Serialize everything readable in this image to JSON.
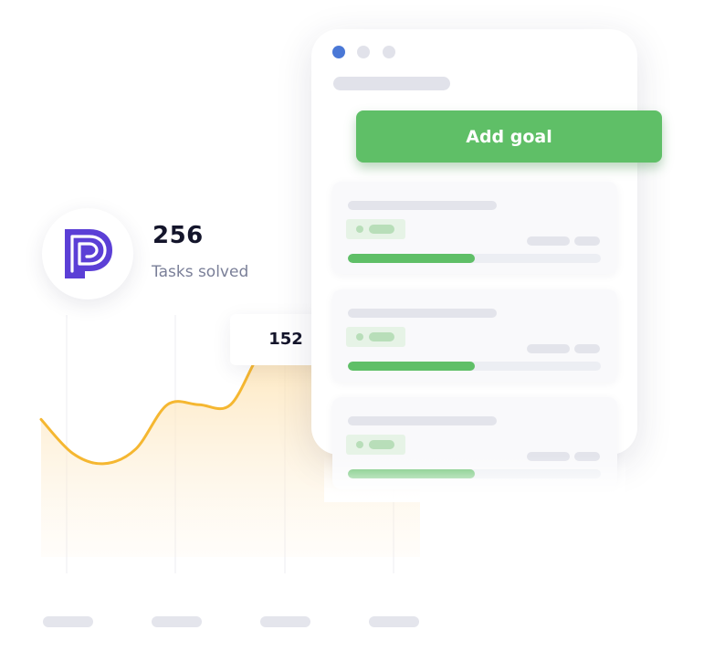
{
  "stat": {
    "value": "256",
    "label": "Tasks solved",
    "logo_icon": "p-logo-icon",
    "logo_color": "#5b3fd6"
  },
  "tooltip": {
    "value": "152"
  },
  "window": {
    "dots": [
      {
        "color": "#4a78d6"
      },
      {
        "color": "#e1e2ea"
      },
      {
        "color": "#e1e2ea"
      }
    ],
    "add_goal_label": "Add goal",
    "accent_color": "#5fbf67",
    "goals": [
      {
        "progress": 0.5
      },
      {
        "progress": 0.5
      },
      {
        "progress": 0.5
      }
    ]
  },
  "chart_data": {
    "type": "area",
    "title": "",
    "xlabel": "",
    "ylabel": "",
    "x": [
      0,
      1,
      2,
      3,
      4,
      5,
      6,
      7,
      8,
      9,
      10,
      11,
      12
    ],
    "series": [
      {
        "values": [
          118,
          95,
          88,
          98,
          128,
          128,
          128,
          165,
          178,
          152,
          138,
          140,
          150
        ]
      }
    ],
    "highlight": {
      "index": 9,
      "value": 152
    },
    "ylim": [
      0,
      260
    ],
    "line_color": "#f5b731",
    "fill_color": "#fde3b3",
    "grid": true,
    "x_tick_count": 4
  }
}
